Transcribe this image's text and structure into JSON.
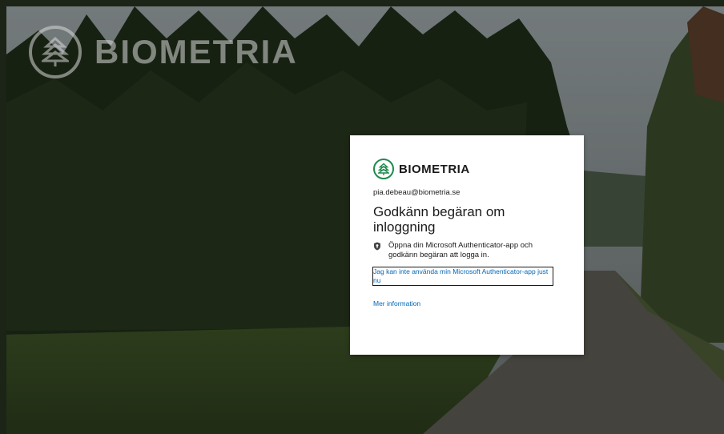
{
  "background": {
    "brand_name": "BIOMETRIA",
    "brand_icon": "tree-logo-icon"
  },
  "card": {
    "brand_name": "BIOMETRIA",
    "brand_icon": "tree-logo-icon",
    "brand_color": "#1f8a4c",
    "email": "pia.debeau@biometria.se",
    "title": "Godkänn begäran om inloggning",
    "instruction": "Öppna din Microsoft Authenticator-app och godkänn begäran att logga in.",
    "instruction_icon": "authenticator-icon",
    "alt_link": "Jag kan inte använda min Microsoft Authenticator-app just nu",
    "more_info_link": "Mer information",
    "link_color": "#0067b8"
  }
}
